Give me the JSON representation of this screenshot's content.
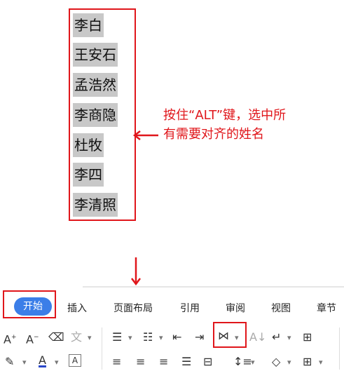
{
  "names": [
    "李白",
    "王安石",
    "孟浩然",
    "李商隐",
    "杜牧",
    "李四",
    "李清照"
  ],
  "note": {
    "line1": "按住“ALT”键，选中所",
    "line2": "有需要对齐的姓名"
  },
  "ribbon": {
    "tabs": [
      "开始",
      "插入",
      "页面布局",
      "引用",
      "审阅",
      "视图",
      "章节"
    ]
  },
  "colors": {
    "annotation_red": "#e0161b",
    "tab_active": "#3b7ee8",
    "selection_gray": "#c8c8c8"
  },
  "icons": [
    "arrow-left-icon",
    "arrow-down-icon",
    "font-grow-icon",
    "font-shrink-icon",
    "clear-format-icon",
    "phonetic-icon",
    "bullet-list-icon",
    "numbered-list-icon",
    "decrease-indent-icon",
    "increase-indent-icon",
    "char-align-icon",
    "sort-icon",
    "line-break-icon",
    "ruler-icon",
    "highlight-icon",
    "font-color-icon",
    "char-border-icon",
    "align-left-icon",
    "align-center-icon",
    "align-right-icon",
    "justify-icon",
    "distributed-icon",
    "line-spacing-icon",
    "shading-icon",
    "borders-icon"
  ]
}
